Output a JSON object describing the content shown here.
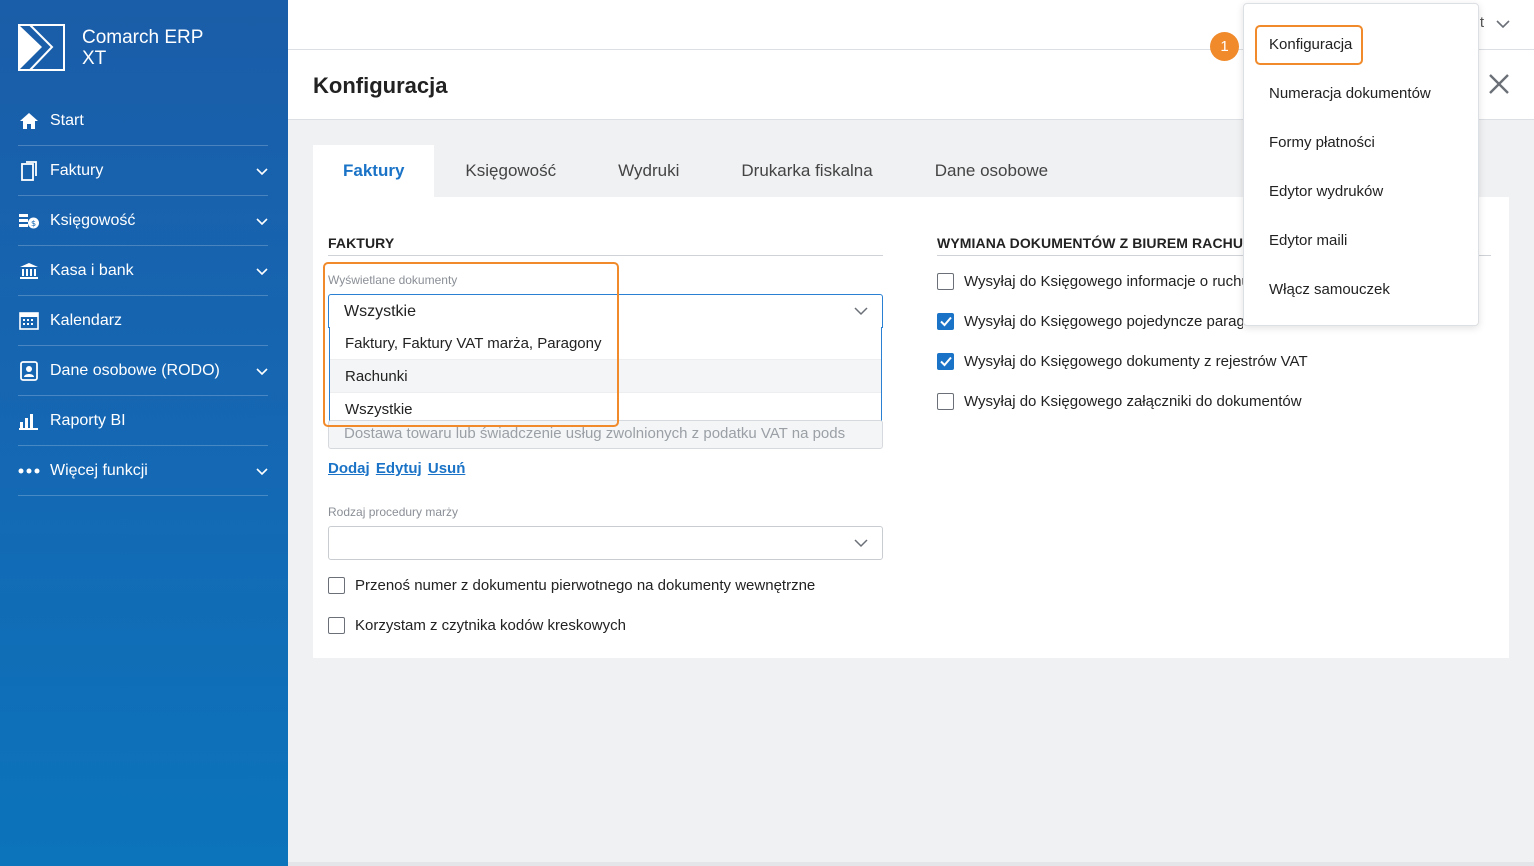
{
  "app": {
    "name_line1": "Comarch ERP",
    "name_line2": "XT"
  },
  "sidebar": {
    "items": [
      {
        "label": "Start",
        "icon": "home-icon",
        "expandable": false
      },
      {
        "label": "Faktury",
        "icon": "document-icon",
        "expandable": true
      },
      {
        "label": "Księgowość",
        "icon": "coins-icon",
        "expandable": true
      },
      {
        "label": "Kasa i bank",
        "icon": "bank-icon",
        "expandable": true
      },
      {
        "label": "Kalendarz",
        "icon": "calendar-icon",
        "expandable": false
      },
      {
        "label": "Dane osobowe (RODO)",
        "icon": "person-card-icon",
        "expandable": true
      },
      {
        "label": "Raporty BI",
        "icon": "bar-chart-icon",
        "expandable": false
      },
      {
        "label": "Więcej funkcji",
        "icon": "more-dots-icon",
        "expandable": true
      }
    ]
  },
  "topbar": {
    "truncated_text": "t"
  },
  "page": {
    "title": "Konfiguracja"
  },
  "tabs": [
    {
      "label": "Faktury",
      "active": true
    },
    {
      "label": "Księgowość",
      "active": false
    },
    {
      "label": "Wydruki",
      "active": false
    },
    {
      "label": "Drukarka fiskalna",
      "active": false
    },
    {
      "label": "Dane osobowe",
      "active": false
    }
  ],
  "faktury": {
    "heading": "FAKTURY",
    "displayed_docs_label": "Wyświetlane dokumenty",
    "displayed_docs_value": "Wszystkie",
    "displayed_docs_options": [
      "Faktury, Faktury VAT marża, Paragony",
      "Rachunki",
      "Wszystkie"
    ],
    "exemption_value": "Dostawa towaru lub świadczenie usług zwolnionych z podatku VAT na pods",
    "links": {
      "add": "Dodaj",
      "edit": "Edytuj",
      "remove": "Usuń"
    },
    "margin_procedure_label": "Rodzaj procedury marży",
    "margin_procedure_value": "",
    "checkboxes": [
      {
        "label": "Przenoś numer z dokumentu pierwotnego na dokumenty wewnętrzne",
        "checked": false
      },
      {
        "label": "Korzystam z czytnika kodów kreskowych",
        "checked": false
      }
    ]
  },
  "exchange": {
    "heading": "WYMIANA DOKUMENTÓW Z BIUREM RACHUNKOWYM",
    "checkboxes": [
      {
        "label": "Wysyłaj do Księgowego informacje o ruchu",
        "checked": false
      },
      {
        "label": "Wysyłaj do Księgowego pojedyncze paragony",
        "checked": true
      },
      {
        "label": "Wysyłaj do Księgowego dokumenty z rejestrów VAT",
        "checked": true
      },
      {
        "label": "Wysyłaj do Księgowego załączniki do dokumentów",
        "checked": false
      }
    ]
  },
  "user_menu": {
    "items": [
      "Konfiguracja",
      "Numeracja dokumentów",
      "Formy płatności",
      "Edytor wydruków",
      "Edytor maili",
      "Włącz samouczek"
    ]
  },
  "callout": {
    "number": "1"
  },
  "colors": {
    "accent": "#1a73c6",
    "highlight": "#f08a2b",
    "sidebar": "#1567b3"
  }
}
